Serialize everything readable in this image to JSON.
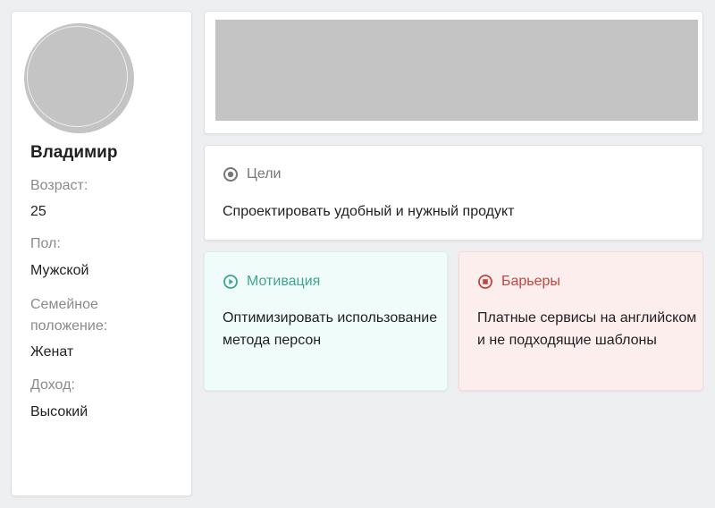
{
  "colors": {
    "background": "#eeeff1",
    "card": "#ffffff",
    "goals_accent": "#777777",
    "motivation_accent": "#3fa58f",
    "motivation_bg": "#effcfa",
    "barriers_accent": "#c0463e",
    "barriers_bg": "#fdeeee",
    "placeholder": "#c4c4c4"
  },
  "profile": {
    "name": "Владимир",
    "fields": [
      {
        "label": "Возраст:",
        "value": "25"
      },
      {
        "label": "Пол:",
        "value": "Мужской"
      },
      {
        "label": "Семейное положение:",
        "value": "Женат"
      },
      {
        "label": "Доход:",
        "value": "Высокий"
      }
    ]
  },
  "goals": {
    "icon": "target-icon",
    "title": "Цели",
    "text": "Спроектировать удобный и нужный продукт"
  },
  "motivation": {
    "icon": "play-circle-icon",
    "title": "Мотивация",
    "text": "Оптимизировать использование метода персон"
  },
  "barriers": {
    "icon": "stop-circle-icon",
    "title": "Барьеры",
    "text": "Платные сервисы на английском и не подходящие шаблоны"
  }
}
